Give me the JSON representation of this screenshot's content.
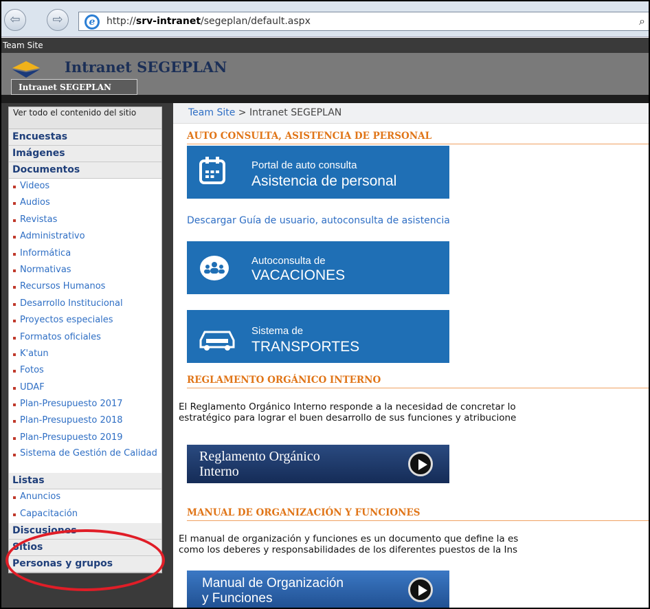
{
  "browser": {
    "url_prefix": "http://",
    "url_host": "srv-intranet",
    "url_path": "/segeplan/default.aspx",
    "back_glyph": "⇦",
    "forward_glyph": "⇨",
    "search_glyph": "⌕"
  },
  "header": {
    "team_site": "Team Site",
    "site_title": "Intranet SEGEPLAN",
    "tab_label": "Intranet SEGEPLAN"
  },
  "sidebar": {
    "view_all": "Ver todo el contenido del sitio",
    "sections": {
      "encuestas": "Encuestas",
      "imagenes": "Imágenes",
      "documentos": "Documentos",
      "listas": "Listas",
      "discusiones": "Discusiones",
      "sitios": "Sitios",
      "personas": "Personas y grupos"
    },
    "documentos_items": [
      "Videos",
      "Audios",
      "Revistas",
      "Administrativo",
      "Informática",
      "Normativas",
      "Recursos Humanos",
      "Desarrollo Institucional",
      "Proyectos especiales",
      "Formatos oficiales",
      "K'atun",
      "Fotos",
      "UDAF",
      "Plan-Presupuesto 2017",
      "Plan-Presupuesto 2018",
      "Plan-Presupuesto 2019",
      "Sistema de Gestión de Calidad"
    ],
    "listas_items": [
      "Anuncios",
      "Capacitación"
    ]
  },
  "main": {
    "breadcrumb_link": "Team Site",
    "breadcrumb_sep": " > ",
    "breadcrumb_current": "Intranet SEGEPLAN",
    "heading1": "AUTO CONSULTA, ASISTENCIA DE PERSONAL",
    "banner1_small": "Portal de auto consulta",
    "banner1_big": "Asistencia de personal",
    "guide_link": "Descargar Guía de usuario, autoconsulta de asistencia",
    "banner2_small": "Autoconsulta de",
    "banner2_big": "VACACIONES",
    "banner3_small": "Sistema de",
    "banner3_big": "TRANSPORTES",
    "heading2": "REGLAMENTO ORGÁNICO INTERNO",
    "para2_line1": "El Reglamento Orgánico Interno responde a la necesidad de concretar lo",
    "para2_line2": "estratégico para lograr el buen desarrollo de sus funciones y atribucione",
    "banner4_line1": "Reglamento Orgánico",
    "banner4_line2": "Interno",
    "heading3": "MANUAL DE ORGANIZACIÓN Y FUNCIONES",
    "para3_line1": "El manual de organización y funciones es un documento que define la es",
    "para3_line2": "como los deberes y responsabilidades de los diferentes puestos de la Ins",
    "banner5_line1": "Manual de Organización",
    "banner5_line2": "y Funciones"
  },
  "colors": {
    "accent_blue": "#1f6fb5",
    "heading_orange": "#e07518",
    "highlight_red": "#e01d27"
  }
}
